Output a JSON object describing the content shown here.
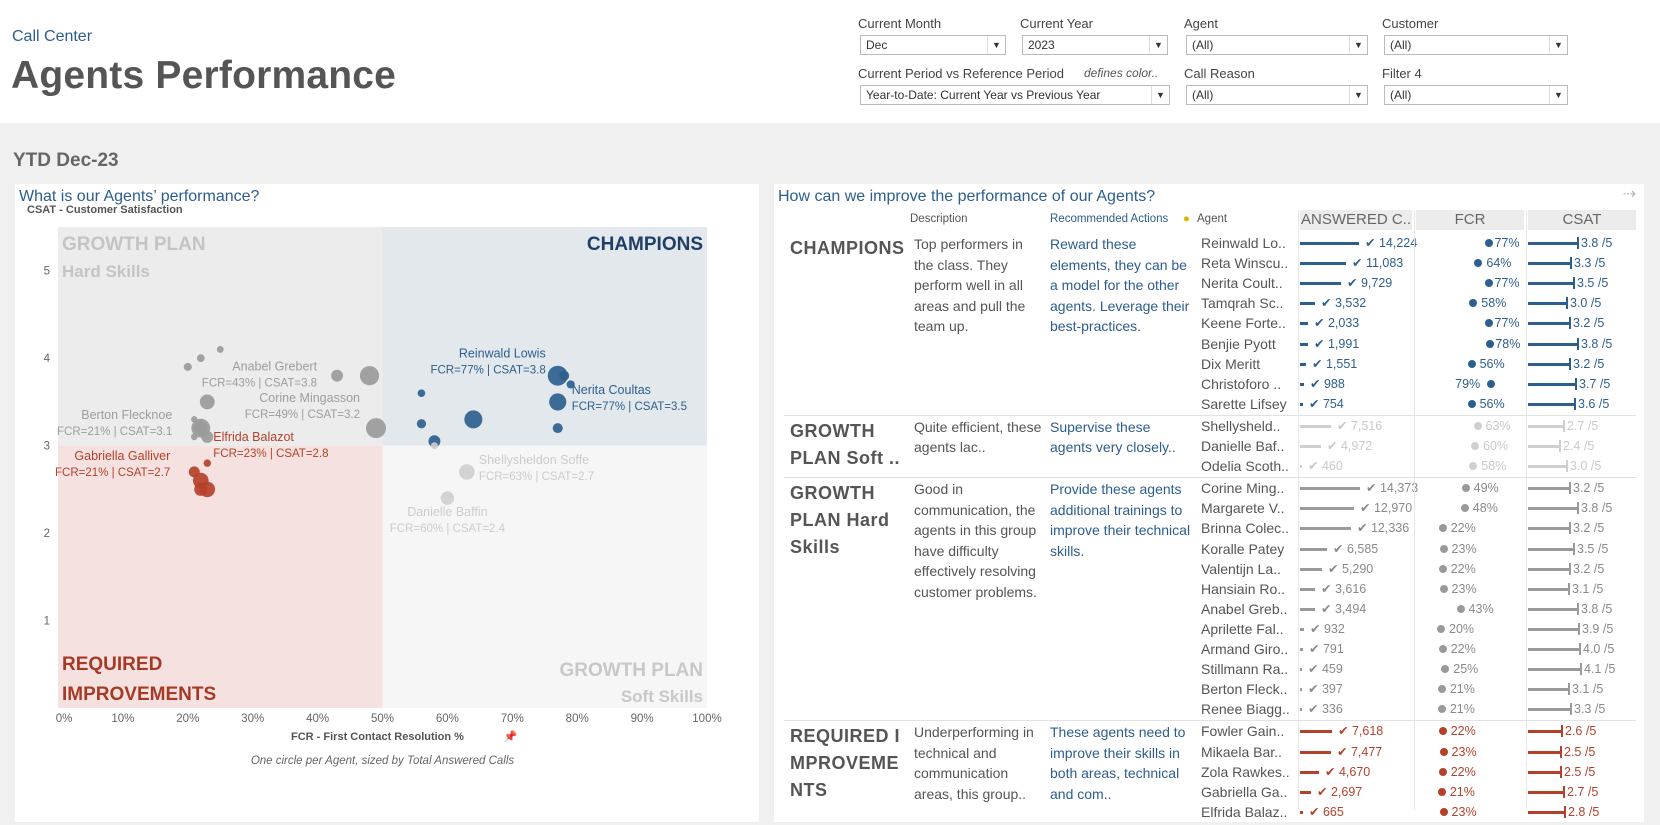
{
  "header": {
    "subtitle": "Call Center",
    "title": "Agents Performance",
    "filters": {
      "current_month": {
        "label": "Current Month",
        "value": "Dec"
      },
      "current_year": {
        "label": "Current Year",
        "value": "2023"
      },
      "agent": {
        "label": "Agent",
        "value": "(All)"
      },
      "customer": {
        "label": "Customer",
        "value": "(All)"
      },
      "period": {
        "label": "Current Period vs Reference Period",
        "note": "defines color..",
        "value": "Year-to-Date: Current Year vs Previous Year"
      },
      "call_reason": {
        "label": "Call Reason",
        "value": "(All)"
      },
      "filter4": {
        "label": "Filter 4",
        "value": "(All)"
      }
    }
  },
  "period_label": "YTD Dec-23",
  "left_panel": {
    "title": "What is our Agents’ performance?",
    "quadrants": {
      "growth_hard_l1": "GROWTH PLAN",
      "growth_hard_l2": "Hard Skills",
      "champions": "CHAMPIONS",
      "required_l1": "REQUIRED",
      "required_l2": "IMPROVEMENTS",
      "growth_soft_l1": "GROWTH PLAN",
      "growth_soft_l2": "Soft Skills"
    },
    "footnote": "One circle per Agent, sized by Total Answered Calls"
  },
  "chart_data": {
    "type": "scatter",
    "ylabel": "CSAT - Customer Satisfaction",
    "xlabel": "FCR - First Contact Resolution %",
    "xlim": [
      0,
      100
    ],
    "ylim": [
      0,
      5.5
    ],
    "x_ticks": [
      "0%",
      "10%",
      "20%",
      "30%",
      "40%",
      "50%",
      "60%",
      "70%",
      "80%",
      "90%",
      "100%"
    ],
    "y_ticks": [
      "1",
      "2",
      "3",
      "4",
      "5"
    ],
    "thresholds": {
      "fcr": 50,
      "csat": 3
    },
    "groups": {
      "CHAMPIONS": "#2d5f8e",
      "GROWTH PLAN Soft Skills": "#cfcfcf",
      "GROWTH PLAN Hard Skills": "#9a9a9a",
      "REQUIRED IMPROVEMENTS": "#b5412b"
    },
    "points": [
      {
        "name": "Reinwald Lowis",
        "fcr": 77,
        "csat": 3.8,
        "calls": 14224,
        "group": "CHAMPIONS",
        "label": "Reinwald Lowis",
        "sublabel": "FCR=77%  |  CSAT=3.8"
      },
      {
        "name": "Reta Winscum",
        "fcr": 64,
        "csat": 3.3,
        "calls": 11083,
        "group": "CHAMPIONS"
      },
      {
        "name": "Nerita Coultas",
        "fcr": 77,
        "csat": 3.5,
        "calls": 9729,
        "group": "CHAMPIONS",
        "label": "Nerita Coultas",
        "sublabel": "FCR=77%  |  CSAT=3.5"
      },
      {
        "name": "Tamqrah Sc",
        "fcr": 58,
        "csat": 3.05,
        "calls": 3532,
        "group": "CHAMPIONS"
      },
      {
        "name": "Keene Forte",
        "fcr": 77,
        "csat": 3.2,
        "calls": 2033,
        "group": "CHAMPIONS"
      },
      {
        "name": "Benjie Pyott",
        "fcr": 78,
        "csat": 3.8,
        "calls": 1991,
        "group": "CHAMPIONS"
      },
      {
        "name": "Dix Meritt",
        "fcr": 56,
        "csat": 3.25,
        "calls": 1551,
        "group": "CHAMPIONS"
      },
      {
        "name": "Christoforo",
        "fcr": 79,
        "csat": 3.7,
        "calls": 988,
        "group": "CHAMPIONS"
      },
      {
        "name": "Sarette Lifsey",
        "fcr": 56,
        "csat": 3.6,
        "calls": 754,
        "group": "CHAMPIONS"
      },
      {
        "name": "Shellysheldon Soffe",
        "fcr": 63,
        "csat": 2.7,
        "calls": 7516,
        "group": "GROWTH PLAN Soft Skills",
        "label": "Shellysheldon Soffe",
        "sublabel": "FCR=63%  |  CSAT=2.7"
      },
      {
        "name": "Danielle Baffin",
        "fcr": 60,
        "csat": 2.4,
        "calls": 4972,
        "group": "GROWTH PLAN Soft Skills",
        "label": "Danielle Baffin",
        "sublabel": "FCR=60%  |  CSAT=2.4"
      },
      {
        "name": "Odelia Scoth",
        "fcr": 58,
        "csat": 3.0,
        "calls": 460,
        "group": "GROWTH PLAN Soft Skills"
      },
      {
        "name": "Corine Mingasson",
        "fcr": 49,
        "csat": 3.2,
        "calls": 14373,
        "group": "GROWTH PLAN Hard Skills",
        "label": "Corine Mingasson",
        "sublabel": "FCR=49%  |  CSAT=3.2"
      },
      {
        "name": "Margarete V",
        "fcr": 48,
        "csat": 3.8,
        "calls": 12970,
        "group": "GROWTH PLAN Hard Skills"
      },
      {
        "name": "Brinna Colec",
        "fcr": 22,
        "csat": 3.2,
        "calls": 12336,
        "group": "GROWTH PLAN Hard Skills"
      },
      {
        "name": "Koralle Patey",
        "fcr": 23,
        "csat": 3.5,
        "calls": 6585,
        "group": "GROWTH PLAN Hard Skills"
      },
      {
        "name": "Valentijn La",
        "fcr": 22,
        "csat": 3.2,
        "calls": 5290,
        "group": "GROWTH PLAN Hard Skills"
      },
      {
        "name": "Hansiain Ro",
        "fcr": 23,
        "csat": 3.1,
        "calls": 3616,
        "group": "GROWTH PLAN Hard Skills"
      },
      {
        "name": "Anabel Grebert",
        "fcr": 43,
        "csat": 3.8,
        "calls": 3494,
        "group": "GROWTH PLAN Hard Skills",
        "label": "Anabel Grebert",
        "sublabel": "FCR=43%  |  CSAT=3.8"
      },
      {
        "name": "Aprilette Fal",
        "fcr": 20,
        "csat": 3.9,
        "calls": 932,
        "group": "GROWTH PLAN Hard Skills"
      },
      {
        "name": "Armand Giro",
        "fcr": 22,
        "csat": 4.0,
        "calls": 791,
        "group": "GROWTH PLAN Hard Skills"
      },
      {
        "name": "Stillmann Ra",
        "fcr": 25,
        "csat": 4.1,
        "calls": 459,
        "group": "GROWTH PLAN Hard Skills"
      },
      {
        "name": "Berton Flecknoe",
        "fcr": 21,
        "csat": 3.1,
        "calls": 397,
        "group": "GROWTH PLAN Hard Skills",
        "label": "Berton Flecknoe",
        "sublabel": "FCR=21%  |  CSAT=3.1"
      },
      {
        "name": "Renee Biagg",
        "fcr": 21,
        "csat": 3.3,
        "calls": 336,
        "group": "GROWTH PLAN Hard Skills"
      },
      {
        "name": "Fowler Gain",
        "fcr": 22,
        "csat": 2.6,
        "calls": 7618,
        "group": "REQUIRED IMPROVEMENTS"
      },
      {
        "name": "Mikaela Bar",
        "fcr": 23,
        "csat": 2.5,
        "calls": 7477,
        "group": "REQUIRED IMPROVEMENTS"
      },
      {
        "name": "Zola Rawkes",
        "fcr": 22,
        "csat": 2.5,
        "calls": 4670,
        "group": "REQUIRED IMPROVEMENTS"
      },
      {
        "name": "Gabriella Galliver",
        "fcr": 21,
        "csat": 2.7,
        "calls": 2697,
        "group": "REQUIRED IMPROVEMENTS",
        "label": "Gabriella Galliver",
        "sublabel": "FCR=21%  |  CSAT=2.7"
      },
      {
        "name": "Elfrida Balazot",
        "fcr": 23,
        "csat": 2.8,
        "calls": 665,
        "group": "REQUIRED IMPROVEMENTS",
        "label": "Elfrida Balazot",
        "sublabel": "FCR=23%  |  CSAT=2.8"
      }
    ]
  },
  "right_panel": {
    "title": "How can we improve the performance of our Agents?",
    "headers": {
      "description": "Description",
      "actions": "Recommended Actions",
      "agent": "Agent",
      "answered": "ANSWERED C..",
      "fcr": "FCR",
      "csat": "CSAT"
    },
    "groups": [
      {
        "name": "CHAMPIONS",
        "description": "Top performers in the class. They perform well in all areas and pull the team up.",
        "actions": "Reward these elements, they can be a model for the other agents. Leverage their best-practices.",
        "color": "#2d5f8e",
        "agents": [
          {
            "name": "Reinwald Lo..",
            "answered": 14224,
            "answered_label": "✔ 14,224",
            "fcr": 77,
            "fcr_label": "77%",
            "csat": 3.8,
            "csat_label": "3.8 /5"
          },
          {
            "name": "Reta Winscu..",
            "answered": 11083,
            "answered_label": "✔ 11,083",
            "fcr": 64,
            "fcr_label": "64%",
            "csat": 3.3,
            "csat_label": "3.3 /5"
          },
          {
            "name": "Nerita Coult..",
            "answered": 9729,
            "answered_label": "✔ 9,729",
            "fcr": 77,
            "fcr_label": "77%",
            "csat": 3.5,
            "csat_label": "3.5 /5"
          },
          {
            "name": "Tamqrah Sc..",
            "answered": 3532,
            "answered_label": "✔ 3,532",
            "fcr": 58,
            "fcr_label": "58%",
            "csat": 3.0,
            "csat_label": "3.0 /5"
          },
          {
            "name": "Keene Forte..",
            "answered": 2033,
            "answered_label": "✔ 2,033",
            "fcr": 77,
            "fcr_label": "77%",
            "csat": 3.2,
            "csat_label": "3.2 /5"
          },
          {
            "name": "Benjie Pyott",
            "answered": 1991,
            "answered_label": "✔ 1,991",
            "fcr": 78,
            "fcr_label": "78%",
            "csat": 3.8,
            "csat_label": "3.8 /5"
          },
          {
            "name": "Dix Meritt",
            "answered": 1551,
            "answered_label": "✔ 1,551",
            "fcr": 56,
            "fcr_label": "56%",
            "csat": 3.2,
            "csat_label": "3.2 /5"
          },
          {
            "name": "Christoforo ..",
            "answered": 988,
            "answered_label": "✔ 988",
            "fcr": 79,
            "fcr_label": "79%",
            "csat": 3.7,
            "csat_label": "3.7 /5"
          },
          {
            "name": "Sarette Lifsey",
            "answered": 754,
            "answered_label": "✔ 754",
            "fcr": 56,
            "fcr_label": "56%",
            "csat": 3.6,
            "csat_label": "3.6 /5"
          }
        ]
      },
      {
        "name": "GROWTH PLAN Soft ..",
        "description": "Quite efficient, these agents lac..",
        "actions": "Supervise these agents very closely..",
        "color": "#cfcfcf",
        "agents": [
          {
            "name": "Shellysheld..",
            "answered": 7516,
            "answered_label": "✔ 7,516",
            "fcr": 63,
            "fcr_label": "63%",
            "csat": 2.7,
            "csat_label": "2.7 /5"
          },
          {
            "name": "Danielle Baf..",
            "answered": 4972,
            "answered_label": "✔ 4,972",
            "fcr": 60,
            "fcr_label": "60%",
            "csat": 2.4,
            "csat_label": "2.4 /5"
          },
          {
            "name": "Odelia Scoth..",
            "answered": 460,
            "answered_label": "✔ 460",
            "fcr": 58,
            "fcr_label": "58%",
            "csat": 3.0,
            "csat_label": "3.0 /5"
          }
        ]
      },
      {
        "name": "GROWTH PLAN Hard Skills",
        "description": "Good in communication, the agents in this group have difficulty effectively resolving customer problems.",
        "actions": "Provide these agents additional trainings to improve their technical skills.",
        "color": "#9a9a9a",
        "agents": [
          {
            "name": "Corine Ming..",
            "answered": 14373,
            "answered_label": "✔ 14,373",
            "fcr": 49,
            "fcr_label": "49%",
            "csat": 3.2,
            "csat_label": "3.2 /5"
          },
          {
            "name": "Margarete V..",
            "answered": 12970,
            "answered_label": "✔ 12,970",
            "fcr": 48,
            "fcr_label": "48%",
            "csat": 3.8,
            "csat_label": "3.8 /5"
          },
          {
            "name": "Brinna Colec..",
            "answered": 12336,
            "answered_label": "✔ 12,336",
            "fcr": 22,
            "fcr_label": "22%",
            "csat": 3.2,
            "csat_label": "3.2 /5"
          },
          {
            "name": "Koralle Patey",
            "answered": 6585,
            "answered_label": "✔ 6,585",
            "fcr": 23,
            "fcr_label": "23%",
            "csat": 3.5,
            "csat_label": "3.5 /5"
          },
          {
            "name": "Valentijn La..",
            "answered": 5290,
            "answered_label": "✔ 5,290",
            "fcr": 22,
            "fcr_label": "22%",
            "csat": 3.2,
            "csat_label": "3.2 /5"
          },
          {
            "name": "Hansiain Ro..",
            "answered": 3616,
            "answered_label": "✔ 3,616",
            "fcr": 23,
            "fcr_label": "23%",
            "csat": 3.1,
            "csat_label": "3.1 /5"
          },
          {
            "name": "Anabel Greb..",
            "answered": 3494,
            "answered_label": "✔ 3,494",
            "fcr": 43,
            "fcr_label": "43%",
            "csat": 3.8,
            "csat_label": "3.8 /5"
          },
          {
            "name": "Aprilette Fal..",
            "answered": 932,
            "answered_label": "✔ 932",
            "fcr": 20,
            "fcr_label": "20%",
            "csat": 3.9,
            "csat_label": "3.9 /5"
          },
          {
            "name": "Armand Giro..",
            "answered": 791,
            "answered_label": "✔ 791",
            "fcr": 22,
            "fcr_label": "22%",
            "csat": 4.0,
            "csat_label": "4.0 /5"
          },
          {
            "name": "Stillmann Ra..",
            "answered": 459,
            "answered_label": "✔ 459",
            "fcr": 25,
            "fcr_label": "25%",
            "csat": 4.1,
            "csat_label": "4.1 /5"
          },
          {
            "name": "Berton Fleck..",
            "answered": 397,
            "answered_label": "✔ 397",
            "fcr": 21,
            "fcr_label": "21%",
            "csat": 3.1,
            "csat_label": "3.1 /5"
          },
          {
            "name": "Renee Biagg..",
            "answered": 336,
            "answered_label": "✔ 336",
            "fcr": 21,
            "fcr_label": "21%",
            "csat": 3.3,
            "csat_label": "3.3 /5"
          }
        ]
      },
      {
        "name": "REQUIRED I MPROVEME NTS",
        "description": "Underperforming in technical and communication areas, this group..",
        "actions": "These agents need to improve their skills in both areas, technical and com..",
        "color": "#b5412b",
        "agents": [
          {
            "name": "Fowler Gain..",
            "answered": 7618,
            "answered_label": "✔ 7,618",
            "fcr": 22,
            "fcr_label": "22%",
            "csat": 2.6,
            "csat_label": "2.6 /5"
          },
          {
            "name": "Mikaela Bar..",
            "answered": 7477,
            "answered_label": "✔ 7,477",
            "fcr": 23,
            "fcr_label": "23%",
            "csat": 2.5,
            "csat_label": "2.5 /5"
          },
          {
            "name": "Zola Rawkes..",
            "answered": 4670,
            "answered_label": "✔ 4,670",
            "fcr": 22,
            "fcr_label": "22%",
            "csat": 2.5,
            "csat_label": "2.5 /5"
          },
          {
            "name": "Gabriella Ga..",
            "answered": 2697,
            "answered_label": "✔ 2,697",
            "fcr": 21,
            "fcr_label": "21%",
            "csat": 2.7,
            "csat_label": "2.7 /5"
          },
          {
            "name": "Elfrida Balaz..",
            "answered": 665,
            "answered_label": "✔ 665",
            "fcr": 23,
            "fcr_label": "23%",
            "csat": 2.8,
            "csat_label": "2.8 /5"
          }
        ]
      }
    ]
  }
}
